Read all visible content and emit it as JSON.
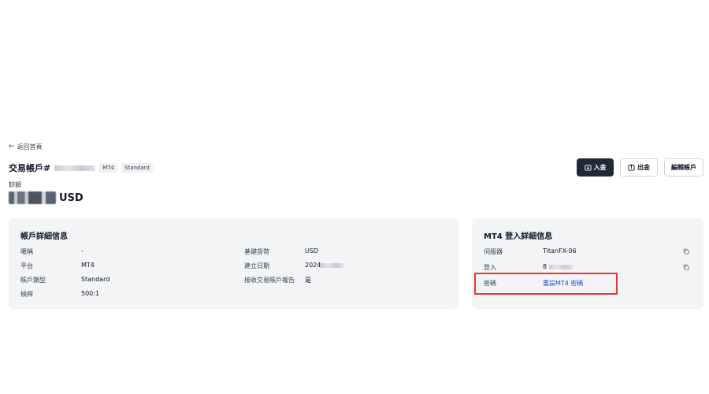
{
  "nav": {
    "back_label": "返回首頁"
  },
  "header": {
    "title": "交易帳戶#",
    "tags": [
      "MT4",
      "Standard"
    ]
  },
  "balance": {
    "label": "餘額",
    "currency": "USD"
  },
  "actions": {
    "deposit_label": "入金",
    "withdraw_label": "出金",
    "edit_label": "編輯帳戶"
  },
  "account_details": {
    "title": "帳戶詳細信息",
    "left": [
      {
        "label": "暱稱",
        "value": "-"
      },
      {
        "label": "平台",
        "value": "MT4"
      },
      {
        "label": "帳戶類型",
        "value": "Standard"
      },
      {
        "label": "槓桿",
        "value": "500:1"
      }
    ],
    "right": [
      {
        "label": "基礎貨幣",
        "value": "USD"
      },
      {
        "label": "建立日期",
        "value": "2024"
      },
      {
        "label": "接收交易帳戶報告",
        "value": "是"
      }
    ]
  },
  "mt4_details": {
    "title": "MT4 登入詳細信息",
    "server_label": "伺服器",
    "server_value": "TitanFX-06",
    "login_label": "登入",
    "login_value": "8",
    "password_label": "密碼",
    "password_link": "重設MT4 密碼"
  },
  "colors": {
    "primary_button": "#1f2937",
    "card_background": "#f3f4f6",
    "link": "#1d4ed8",
    "highlight": "#e53935"
  }
}
